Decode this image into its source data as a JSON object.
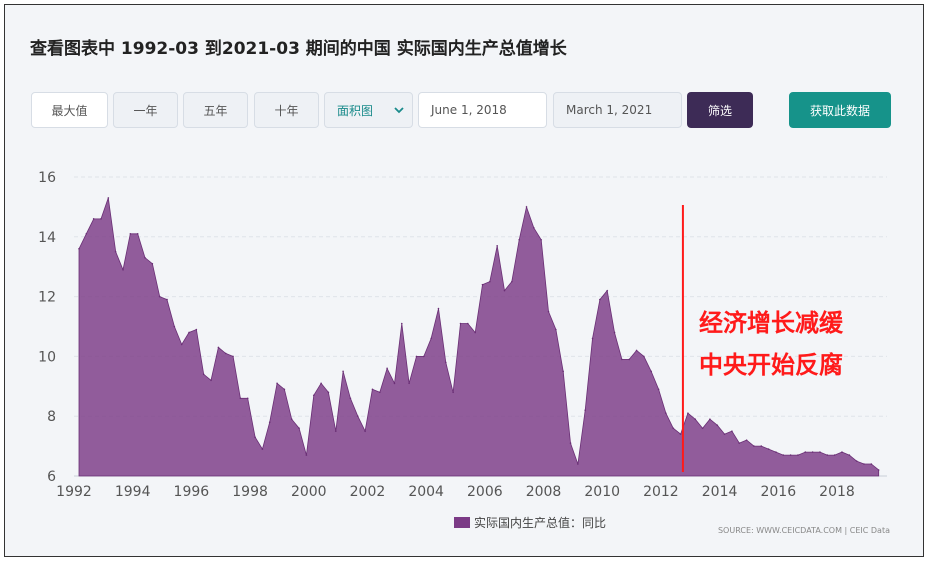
{
  "title": "查看图表中 1992-03 到2021-03 期间的中国 实际国内生产总值增长",
  "controls": {
    "range_max": "最大值",
    "range_1y": "一年",
    "range_5y": "五年",
    "range_10y": "十年",
    "chart_type": "面积图",
    "date_from": "June 1, 2018",
    "date_to": "March 1, 2021",
    "filter_button": "筛选",
    "get_data_button": "获取此数据"
  },
  "annotation": {
    "line1": "经济增长减缓",
    "line2": "中央开始反腐",
    "marker_year": 2012.75
  },
  "source_text": "SOURCE: WWW.CEICDATA.COM | CEIC Data",
  "colors": {
    "area": "#7b3a86",
    "annotation": "#ff1a1a",
    "filter_button": "#3d2b56",
    "get_data_button": "#16938a"
  },
  "chart_data": {
    "type": "area",
    "title": "",
    "xlabel": "",
    "ylabel": "",
    "xlim": [
      1992,
      2019.5
    ],
    "ylim": [
      6,
      16
    ],
    "x_ticks": [
      "1992",
      "1994",
      "1996",
      "1998",
      "2000",
      "2002",
      "2004",
      "2006",
      "2008",
      "2010",
      "2012",
      "2014",
      "2016",
      "2018"
    ],
    "y_ticks": [
      "6",
      "8",
      "10",
      "12",
      "14",
      "16"
    ],
    "grid": "horizontal",
    "legend": "bottom",
    "series": [
      {
        "name": "实际国内生产总值：同比",
        "x": [
          1992.17,
          1992.42,
          1992.67,
          1992.92,
          1993.17,
          1993.42,
          1993.67,
          1993.92,
          1994.17,
          1994.42,
          1994.67,
          1994.92,
          1995.17,
          1995.42,
          1995.67,
          1995.92,
          1996.17,
          1996.42,
          1996.67,
          1996.92,
          1997.17,
          1997.42,
          1997.67,
          1997.92,
          1998.17,
          1998.42,
          1998.67,
          1998.92,
          1999.17,
          1999.42,
          1999.67,
          1999.92,
          2000.17,
          2000.42,
          2000.67,
          2000.92,
          2001.17,
          2001.42,
          2001.67,
          2001.92,
          2002.17,
          2002.42,
          2002.67,
          2002.92,
          2003.17,
          2003.42,
          2003.67,
          2003.92,
          2004.17,
          2004.42,
          2004.67,
          2004.92,
          2005.17,
          2005.42,
          2005.67,
          2005.92,
          2006.17,
          2006.42,
          2006.67,
          2006.92,
          2007.17,
          2007.42,
          2007.67,
          2007.92,
          2008.17,
          2008.42,
          2008.67,
          2008.92,
          2009.17,
          2009.42,
          2009.67,
          2009.92,
          2010.17,
          2010.42,
          2010.67,
          2010.92,
          2011.17,
          2011.42,
          2011.67,
          2011.92,
          2012.17,
          2012.42,
          2012.67,
          2012.92,
          2013.17,
          2013.42,
          2013.67,
          2013.92,
          2014.17,
          2014.42,
          2014.67,
          2014.92,
          2015.17,
          2015.42,
          2015.67,
          2015.92,
          2016.17,
          2016.42,
          2016.67,
          2016.92,
          2017.17,
          2017.42,
          2017.67,
          2017.92,
          2018.17,
          2018.42,
          2018.67,
          2018.92,
          2019.17,
          2019.42
        ],
        "values": [
          13.6,
          14.1,
          14.6,
          14.6,
          15.3,
          13.5,
          12.9,
          14.1,
          14.1,
          13.3,
          13.1,
          12.0,
          11.9,
          11.0,
          10.4,
          10.8,
          10.9,
          9.4,
          9.2,
          10.3,
          10.1,
          10.0,
          8.6,
          8.6,
          7.3,
          6.9,
          7.8,
          9.1,
          8.9,
          7.9,
          7.6,
          6.7,
          8.7,
          9.1,
          8.8,
          7.5,
          9.5,
          8.6,
          8.0,
          7.5,
          8.9,
          8.8,
          9.6,
          9.1,
          11.1,
          9.1,
          10.0,
          10.0,
          10.6,
          11.6,
          9.8,
          8.8,
          11.1,
          11.1,
          10.8,
          12.4,
          12.5,
          13.7,
          12.2,
          12.5,
          13.9,
          15.0,
          14.3,
          13.9,
          11.5,
          10.9,
          9.5,
          7.1,
          6.4,
          8.2,
          10.6,
          11.9,
          12.2,
          10.8,
          9.9,
          9.9,
          10.2,
          10.0,
          9.5,
          8.9,
          8.1,
          7.6,
          7.4,
          8.1,
          7.9,
          7.6,
          7.9,
          7.7,
          7.4,
          7.5,
          7.1,
          7.2,
          7.0,
          7.0,
          6.9,
          6.8,
          6.7,
          6.7,
          6.7,
          6.8,
          6.8,
          6.8,
          6.7,
          6.7,
          6.8,
          6.7,
          6.5,
          6.4,
          6.4,
          6.2
        ]
      }
    ]
  }
}
